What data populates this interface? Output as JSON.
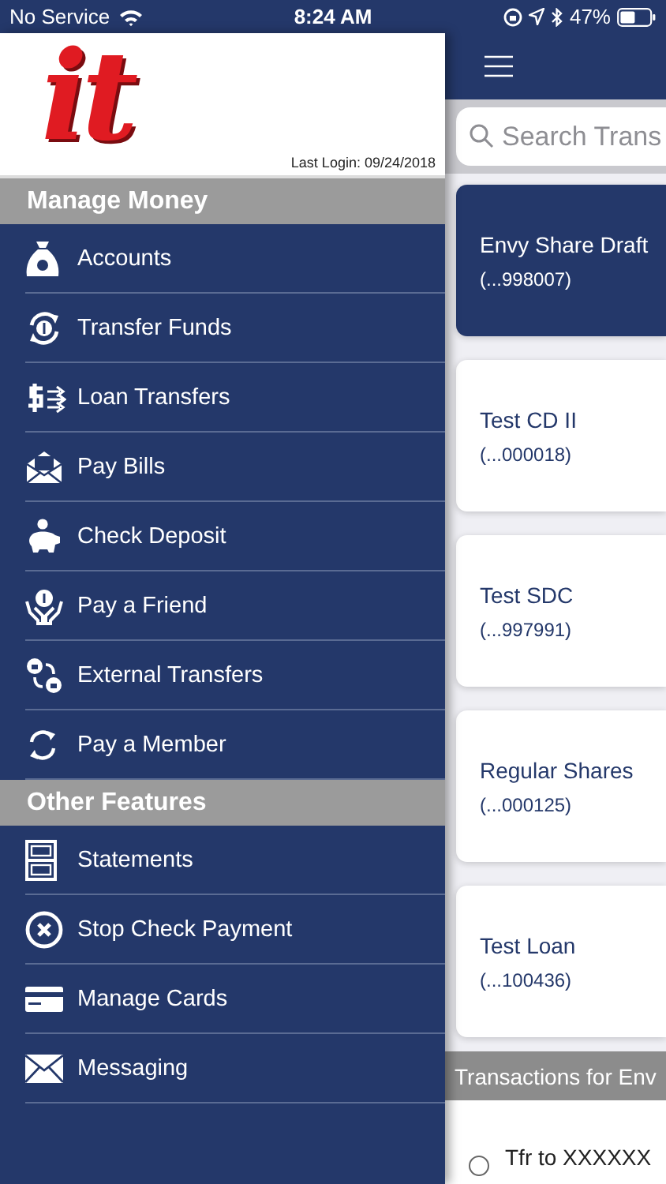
{
  "status_bar": {
    "carrier": "No Service",
    "time": "8:24 AM",
    "battery": "47%"
  },
  "drawer": {
    "logo": "it",
    "last_login": "Last Login:  09/24/2018",
    "sections": [
      {
        "title": "Manage Money",
        "items": [
          {
            "label": "Accounts"
          },
          {
            "label": "Transfer Funds"
          },
          {
            "label": "Loan Transfers"
          },
          {
            "label": "Pay Bills"
          },
          {
            "label": "Check Deposit"
          },
          {
            "label": "Pay a Friend"
          },
          {
            "label": "External Transfers"
          },
          {
            "label": "Pay a Member"
          }
        ]
      },
      {
        "title": "Other Features",
        "items": [
          {
            "label": "Statements"
          },
          {
            "label": "Stop Check Payment"
          },
          {
            "label": "Manage Cards"
          },
          {
            "label": "Messaging"
          }
        ]
      }
    ]
  },
  "main": {
    "search": {
      "placeholder": "Search Trans"
    },
    "accounts": [
      {
        "name": "Envy Share Draft",
        "number": "(...998007)",
        "selected": true
      },
      {
        "name": "Test CD II",
        "number": "(...000018)",
        "selected": false
      },
      {
        "name": "Test SDC",
        "number": "(...997991)",
        "selected": false
      },
      {
        "name": "Regular Shares",
        "number": "(...000125)",
        "selected": false
      },
      {
        "name": "Test Loan",
        "number": "(...100436)",
        "selected": false
      }
    ],
    "transactions_header": "Transactions for Env",
    "transactions": [
      {
        "description": "Tfr to XXXXXX",
        "selected": false
      }
    ]
  }
}
